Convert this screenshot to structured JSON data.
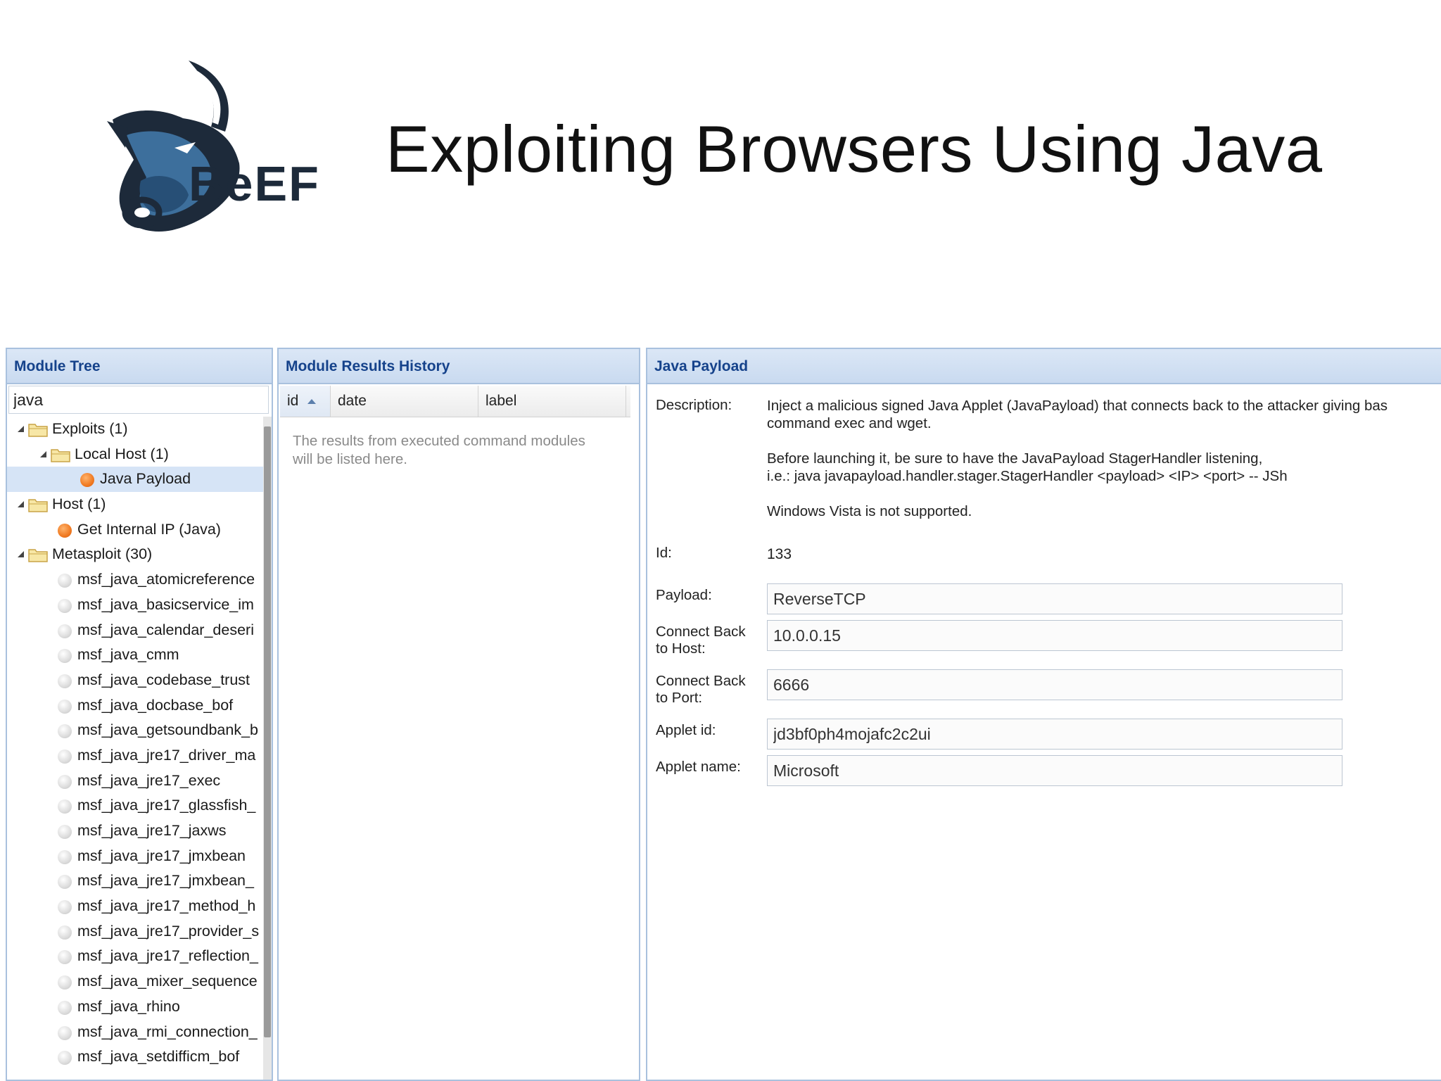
{
  "slide": {
    "title": "Exploiting Browsers Using Java",
    "logo_text": "BeEF"
  },
  "tree_panel": {
    "title": "Module Tree",
    "search_value": "java",
    "items": [
      {
        "label": "Exploits (1)",
        "level": 0,
        "icon": "folder-icon",
        "expanded": true
      },
      {
        "label": "Local Host (1)",
        "level": 1,
        "icon": "folder-icon",
        "expanded": true
      },
      {
        "label": "Java Payload",
        "level": 2,
        "icon": "status-orange-icon",
        "selected": true
      },
      {
        "label": "Host (1)",
        "level": 0,
        "icon": "folder-icon",
        "expanded": true
      },
      {
        "label": "Get Internal IP (Java)",
        "level": 1,
        "icon": "status-orange-icon"
      },
      {
        "label": "Metasploit (30)",
        "level": 0,
        "icon": "folder-icon",
        "expanded": true
      },
      {
        "label": "msf_java_atomicreference",
        "level": 1,
        "icon": "status-grey-icon"
      },
      {
        "label": "msf_java_basicservice_im",
        "level": 1,
        "icon": "status-grey-icon"
      },
      {
        "label": "msf_java_calendar_deseri",
        "level": 1,
        "icon": "status-grey-icon"
      },
      {
        "label": "msf_java_cmm",
        "level": 1,
        "icon": "status-grey-icon"
      },
      {
        "label": "msf_java_codebase_trust",
        "level": 1,
        "icon": "status-grey-icon"
      },
      {
        "label": "msf_java_docbase_bof",
        "level": 1,
        "icon": "status-grey-icon"
      },
      {
        "label": "msf_java_getsoundbank_b",
        "level": 1,
        "icon": "status-grey-icon"
      },
      {
        "label": "msf_java_jre17_driver_ma",
        "level": 1,
        "icon": "status-grey-icon"
      },
      {
        "label": "msf_java_jre17_exec",
        "level": 1,
        "icon": "status-grey-icon"
      },
      {
        "label": "msf_java_jre17_glassfish_",
        "level": 1,
        "icon": "status-grey-icon"
      },
      {
        "label": "msf_java_jre17_jaxws",
        "level": 1,
        "icon": "status-grey-icon"
      },
      {
        "label": "msf_java_jre17_jmxbean",
        "level": 1,
        "icon": "status-grey-icon"
      },
      {
        "label": "msf_java_jre17_jmxbean_",
        "level": 1,
        "icon": "status-grey-icon"
      },
      {
        "label": "msf_java_jre17_method_h",
        "level": 1,
        "icon": "status-grey-icon"
      },
      {
        "label": "msf_java_jre17_provider_s",
        "level": 1,
        "icon": "status-grey-icon"
      },
      {
        "label": "msf_java_jre17_reflection_",
        "level": 1,
        "icon": "status-grey-icon"
      },
      {
        "label": "msf_java_mixer_sequence",
        "level": 1,
        "icon": "status-grey-icon"
      },
      {
        "label": "msf_java_rhino",
        "level": 1,
        "icon": "status-grey-icon"
      },
      {
        "label": "msf_java_rmi_connection_",
        "level": 1,
        "icon": "status-grey-icon"
      },
      {
        "label": "msf_java_setdifficm_bof",
        "level": 1,
        "icon": "status-grey-icon"
      }
    ]
  },
  "results_panel": {
    "title": "Module Results History",
    "columns": [
      {
        "label": "id",
        "sorted": "ascending"
      },
      {
        "label": "date"
      },
      {
        "label": "label"
      }
    ],
    "empty_line1": "The results from executed command modules",
    "empty_line2": "will be listed here."
  },
  "payload_panel": {
    "title": "Java Payload",
    "description_label": "Description:",
    "description": {
      "line1": "Inject a malicious signed Java Applet (JavaPayload) that connects back to the attacker giving bas",
      "line2": "command exec and wget.",
      "line3": "Before launching it, be sure to have the JavaPayload StagerHandler listening,",
      "line4": "i.e.: java javapayload.handler.stager.StagerHandler <payload> <IP> <port> -- JSh",
      "line5": "Windows Vista is not supported."
    },
    "id_label": "Id:",
    "id_value": "133",
    "payload_label": "Payload:",
    "payload_value": "ReverseTCP",
    "host_label_1": "Connect Back",
    "host_label_2": "to Host:",
    "host_value": "10.0.0.15",
    "port_label_1": "Connect Back",
    "port_label_2": "to Port:",
    "port_value": "6666",
    "applet_id_label": "Applet id:",
    "applet_id_value": "jd3bf0ph4mojafc2c2ui",
    "applet_name_label": "Applet name:",
    "applet_name_value": "Microsoft"
  }
}
